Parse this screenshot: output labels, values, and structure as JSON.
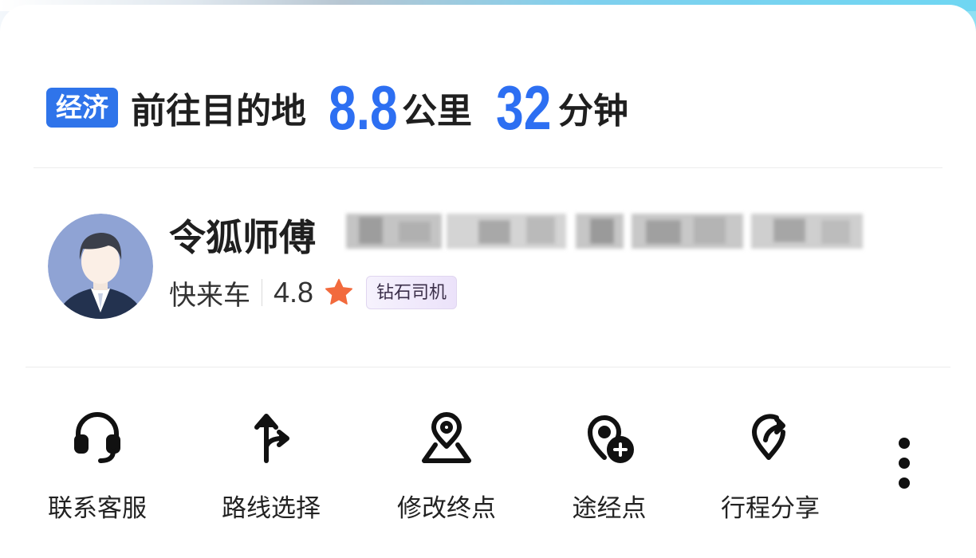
{
  "header": {
    "tag": "经济",
    "destination_text": "前往目的地",
    "distance_value": "8.8",
    "distance_unit": "公里",
    "time_value": "32",
    "time_unit": "分钟"
  },
  "driver": {
    "name": "令狐师傅",
    "car_type": "快来车",
    "rating": "4.8",
    "badge": "钻石司机"
  },
  "actions": [
    {
      "label": "联系客服",
      "icon": "headset-icon"
    },
    {
      "label": "路线选择",
      "icon": "route-fork-icon"
    },
    {
      "label": "修改终点",
      "icon": "map-pin-edit-icon"
    },
    {
      "label": "途经点",
      "icon": "waypoint-add-icon"
    },
    {
      "label": "行程分享",
      "icon": "share-trip-icon"
    }
  ],
  "colors": {
    "accent": "#2d6ff2",
    "tag_bg": "#2f74ea",
    "star": "#f26a3d"
  }
}
